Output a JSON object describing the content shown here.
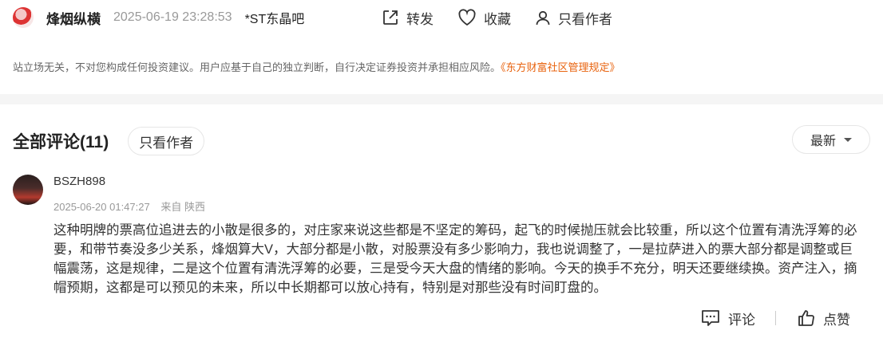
{
  "post": {
    "author": "烽烟纵横",
    "time": "2025-06-19 23:28:53",
    "bar": "*ST东晶吧",
    "actions": {
      "forward": "转发",
      "favorite": "收藏",
      "author_only": "只看作者"
    },
    "disclaimer": "站立场无关，不对您构成任何投资建议。用户应基于自己的独立判断，自行决定证券投资并承担相应风险。",
    "disclaimer_link": "《东方财富社区管理规定》"
  },
  "comments": {
    "title": "全部评论(11)",
    "author_only_label": "只看作者",
    "sort_label": "最新",
    "items": [
      {
        "user": "BSZH898",
        "time": "2025-06-20 01:47:27",
        "location": "来自 陕西",
        "text": "这种明牌的票高位追进去的小散是很多的，对庄家来说这些都是不坚定的筹码，起飞的时候抛压就会比较重，所以这个位置有清洗浮筹的必要，和带节奏没多少关系，烽烟算大V，大部分都是小散，对股票没有多少影响力，我也说调整了，一是拉萨进入的票大部分都是调整或巨幅震荡，这是规律，二是这个位置有清洗浮筹的必要，三是受今天大盘的情绪的影响。今天的换手不充分，明天还要继续换。资产注入，摘帽预期，这都是可以预见的未来，所以中长期都可以放心持有，特别是对那些没有时间盯盘的。",
        "reply_label": "评论",
        "like_label": "点赞"
      }
    ]
  },
  "colors": {
    "accent_link": "#e8620d",
    "muted_text": "#999999",
    "page_bg": "#f5f5f5"
  }
}
